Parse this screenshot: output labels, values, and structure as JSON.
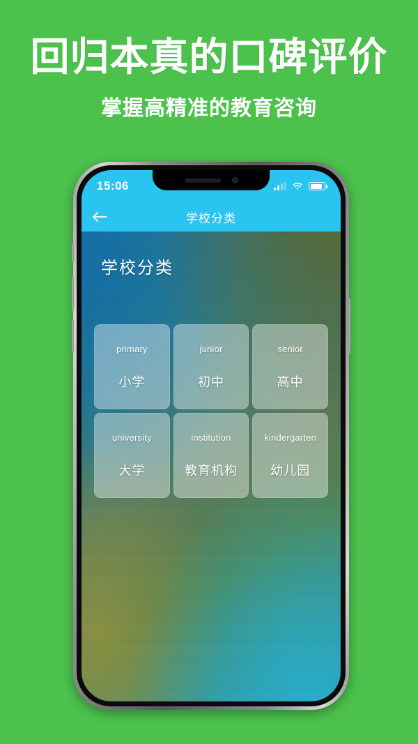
{
  "promo": {
    "title": "回归本真的口碑评价",
    "subtitle": "掌握高精准的教育咨询"
  },
  "colors": {
    "background_green": "#4cc24d",
    "nav_cyan": "#2ac4f1",
    "text_white": "#ffffff"
  },
  "phone": {
    "statusbar": {
      "time": "15:06",
      "signal_icon": "signal-bars-icon",
      "wifi_icon": "wifi-icon",
      "battery_icon": "battery-icon"
    },
    "navbar": {
      "back_icon": "back-arrow-icon",
      "title": "学校分类"
    },
    "page": {
      "heading": "学校分类",
      "categories": [
        {
          "en": "primary",
          "cn": "小学"
        },
        {
          "en": "junior",
          "cn": "初中"
        },
        {
          "en": "senior",
          "cn": "高中"
        },
        {
          "en": "university",
          "cn": "大学"
        },
        {
          "en": "institution",
          "cn": "教育机构"
        },
        {
          "en": "kindergarten",
          "cn": "幼儿园"
        }
      ]
    }
  }
}
